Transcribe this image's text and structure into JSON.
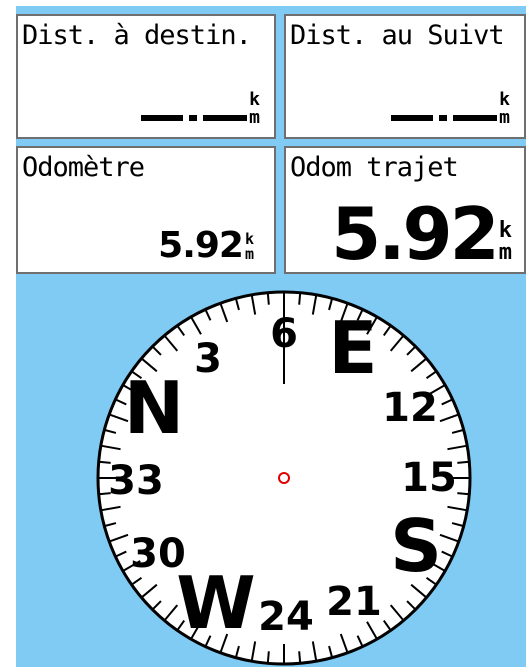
{
  "fields": [
    {
      "label": "Dist. à destin.",
      "value": "",
      "unit_top": "k",
      "unit_bottom": "m"
    },
    {
      "label": "Dist. au Suivt",
      "value": "",
      "unit_top": "k",
      "unit_bottom": "m"
    },
    {
      "label": "Odomètre",
      "value": "5.92",
      "unit_top": "k",
      "unit_bottom": "m"
    },
    {
      "label": "Odom trajet",
      "value": "5.92",
      "unit_top": "k",
      "unit_bottom": "m"
    }
  ],
  "compass": {
    "cardinals": [
      "N",
      "E",
      "S",
      "W"
    ],
    "numbers": [
      "3",
      "6",
      "12",
      "15",
      "21",
      "24",
      "30",
      "33"
    ],
    "colors": {
      "face": "#ffffff",
      "ink": "#000000",
      "center": "#e00000",
      "background": "#7fcbf3"
    }
  }
}
